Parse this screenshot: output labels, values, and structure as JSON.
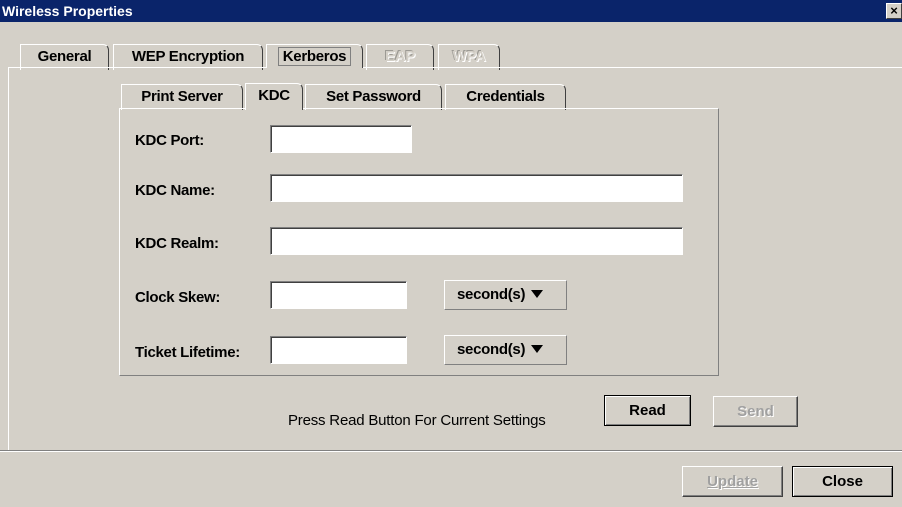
{
  "window": {
    "title": "Wireless Properties",
    "close_glyph": "×"
  },
  "main_tabs": [
    {
      "label": "General",
      "state": "normal"
    },
    {
      "label": "WEP Encryption",
      "state": "normal"
    },
    {
      "label": "Kerberos",
      "state": "selected"
    },
    {
      "label": "EAP",
      "state": "disabled"
    },
    {
      "label": "WPA",
      "state": "disabled"
    }
  ],
  "sub_tabs": [
    {
      "label": "Print Server",
      "state": "normal"
    },
    {
      "label": "KDC",
      "state": "selected"
    },
    {
      "label": "Set Password",
      "state": "normal"
    },
    {
      "label": "Credentials",
      "state": "normal"
    }
  ],
  "form": {
    "kdc_port": {
      "label": "KDC Port:",
      "value": ""
    },
    "kdc_name": {
      "label": "KDC Name:",
      "value": ""
    },
    "kdc_realm": {
      "label": "KDC Realm:",
      "value": ""
    },
    "clock_skew": {
      "label": "Clock Skew:",
      "value": "",
      "unit": "second(s)"
    },
    "ticket_lifetime": {
      "label": "Ticket Lifetime:",
      "value": "",
      "unit": "second(s)"
    }
  },
  "actions": {
    "hint": "Press Read Button For Current Settings",
    "read_label": "Read",
    "send_label": "Send"
  },
  "footer": {
    "update_label": "Update",
    "close_label": "Close"
  }
}
